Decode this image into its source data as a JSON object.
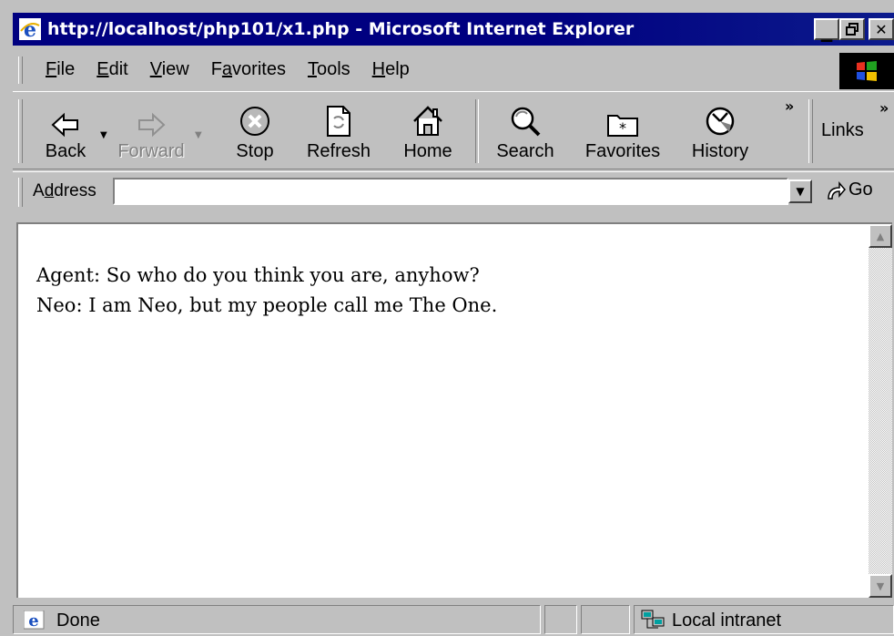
{
  "window": {
    "title": "http://localhost/php101/x1.php - Microsoft Internet Explorer",
    "minimize": "_",
    "maximize": "□",
    "close": "✕"
  },
  "menu": [
    {
      "label": "File",
      "accel": "F",
      "rest": "ile"
    },
    {
      "label": "Edit",
      "accel": "E",
      "rest": "dit"
    },
    {
      "label": "View",
      "accel": "V",
      "rest": "iew"
    },
    {
      "label": "Favorites",
      "pre": "F",
      "accel": "a",
      "rest": "vorites"
    },
    {
      "label": "Tools",
      "accel": "T",
      "rest": "ools"
    },
    {
      "label": "Help",
      "accel": "H",
      "rest": "elp"
    }
  ],
  "toolbar": {
    "back": "Back",
    "forward": "Forward",
    "stop": "Stop",
    "refresh": "Refresh",
    "home": "Home",
    "search": "Search",
    "favorites": "Favorites",
    "history": "History",
    "links": "Links",
    "more": "»"
  },
  "address": {
    "label": "Address",
    "value": "",
    "go": "Go"
  },
  "content": {
    "lines": [
      "Agent: So who do you think you are, anyhow?",
      "Neo: I am Neo, but my people call me The One."
    ]
  },
  "status": {
    "text": "Done",
    "zone": "Local intranet"
  },
  "colors": {
    "titlebar": "#000080",
    "chrome": "#c0c0c0"
  }
}
